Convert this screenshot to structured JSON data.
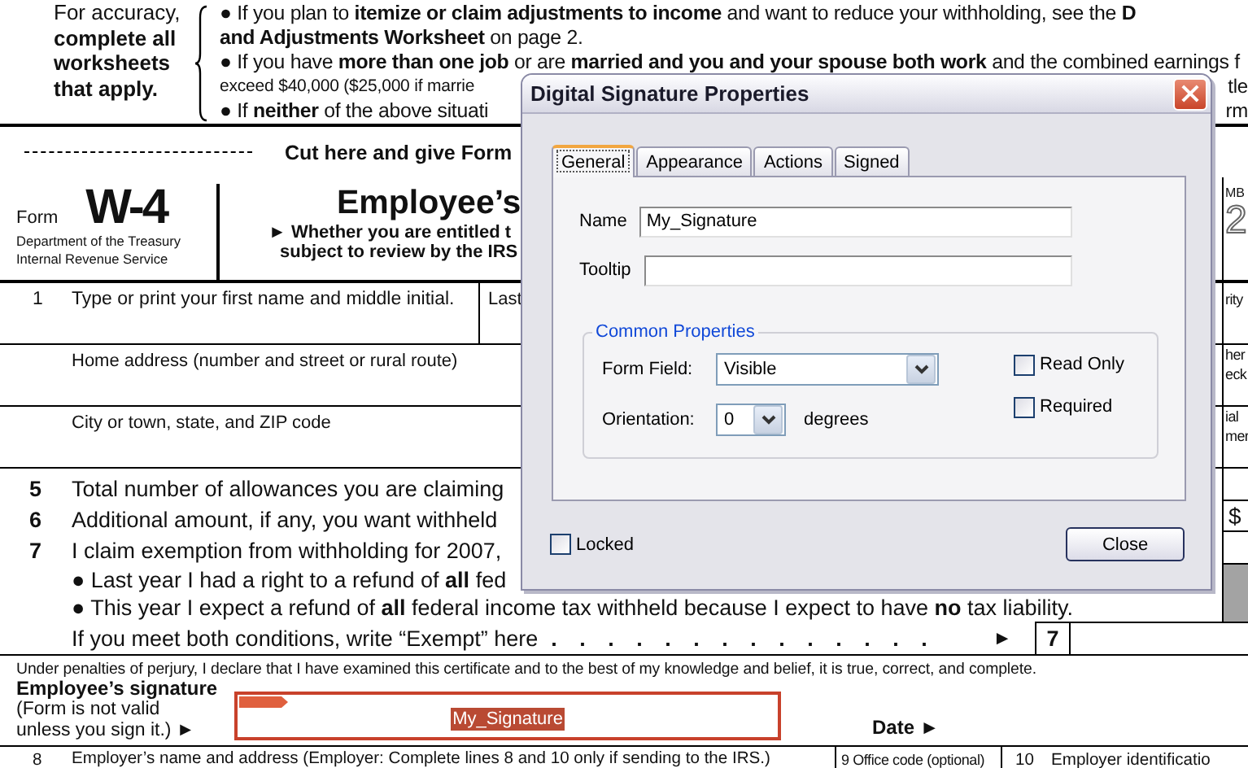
{
  "document": {
    "intro": {
      "note": "For accuracy, **complete all worksheets that apply.**",
      "lines": [
        {
          "kind": "normal",
          "text": "● If you plan to **itemize or claim adjustments to income** and want to reduce your withholding, see the **D**"
        },
        {
          "kind": "normal",
          "text": "**and Adjustments Worksheet** on page 2."
        },
        {
          "kind": "normal",
          "text": "● If you have **more than one job** or are **married and you and your spouse both work** and the combined earnings f"
        },
        {
          "kind": "small",
          "text": "exceed $40,000 ($25,000 if marrie",
          "edge": "tle"
        },
        {
          "kind": "normal",
          "text": "● If **neither** of the above situati",
          "edge": "rm"
        }
      ]
    },
    "cut_text": "Cut here and give Form",
    "header": {
      "form_label": "Form",
      "form_number": "W-4",
      "agency_lines": [
        "Department of the Treasury",
        "Internal Revenue Service"
      ],
      "title": "Employee’s",
      "subtitle_lines": [
        "► Whether you are entitled t",
        "subject to review by the IRS"
      ],
      "omb": "MB",
      "year": "2"
    },
    "name_row": {
      "number": "1",
      "label": "Type or print your first name and middle initial.",
      "last_label": "Last",
      "edge": [
        "rity"
      ]
    },
    "address_rows": [
      {
        "label": "Home address (number and street or rural route)",
        "edge": [
          "her",
          "eck"
        ]
      },
      {
        "label": "City or town, state, and ZIP code",
        "edge": [
          "ial",
          "mer"
        ]
      }
    ],
    "items": [
      {
        "number": "5",
        "text": "Total number of allowances you are claiming"
      },
      {
        "number": "6",
        "text": "Additional amount, if any, you want withheld",
        "edge": "$"
      },
      {
        "number": "7",
        "text": "I claim exemption from withholding for 2007,"
      }
    ],
    "exempt_lines": [
      "● Last year I had a right to a refund of **all** fed",
      "● This year I expect a refund of **all** federal income tax withheld because I expect to have **no** tax liability."
    ],
    "exempt_prompt": {
      "text": "If you meet both conditions, write “Exempt” here",
      "leader": ". . . . . . . . . . . . . .",
      "arrow": "►",
      "box_number": "7"
    },
    "declaration": "Under penalties of perjury, I declare that I have examined this certificate and to the best of my knowledge and belief, it is true, correct, and complete.",
    "signature": {
      "label": "Employee’s signature",
      "note_lines": [
        "(Form is not valid",
        "unless you sign it.) ►"
      ],
      "value": "My_Signature",
      "date_label": "Date ►"
    },
    "employer_row": {
      "number": "8",
      "label": "Employer’s name and address (Employer: Complete lines 8 and 10 only if sending to the IRS.)",
      "office_label": "9 Office code (optional)",
      "ein_number": "10",
      "ein_label": "Employer identificatio"
    }
  },
  "dialog": {
    "title": "Digital Signature Properties",
    "tabs": [
      {
        "label": "General",
        "selected": true
      },
      {
        "label": "Appearance",
        "selected": false
      },
      {
        "label": "Actions",
        "selected": false
      },
      {
        "label": "Signed",
        "selected": false
      }
    ],
    "name": {
      "label": "Name",
      "value": "My_Signature"
    },
    "tooltip": {
      "label": "Tooltip"
    },
    "group": {
      "title": "Common Properties",
      "form_field": {
        "label": "Form Field:",
        "value": "Visible"
      },
      "orientation": {
        "label": "Orientation:",
        "value": "0",
        "unit": "degrees"
      },
      "options": [
        {
          "label": "Read Only",
          "checked": false
        },
        {
          "label": "Required",
          "checked": false
        }
      ]
    },
    "locked": {
      "label": "Locked",
      "checked": false
    },
    "close_label": "Close"
  }
}
